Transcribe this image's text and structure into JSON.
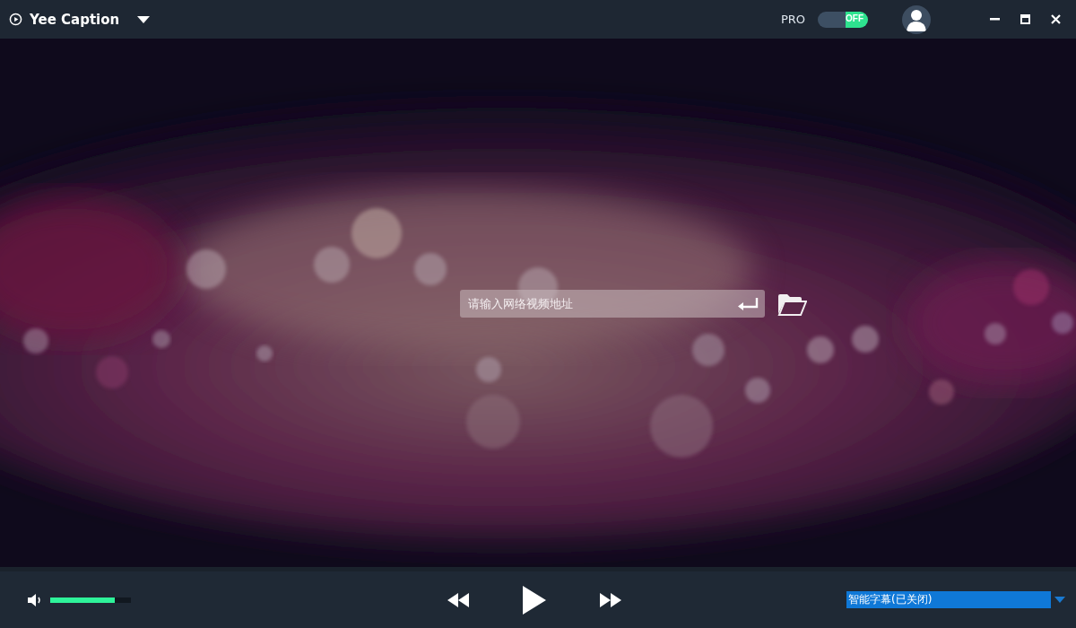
{
  "window": {
    "title": "Yee Caption"
  },
  "pro": {
    "label": "PRO",
    "toggle": {
      "label": "OFF",
      "on": false
    }
  },
  "url_input": {
    "placeholder": "请输入网络视频地址"
  },
  "volume": {
    "level": 0.8
  },
  "subtitle_select": {
    "value": "智能字幕(已关闭)",
    "selected": true
  }
}
